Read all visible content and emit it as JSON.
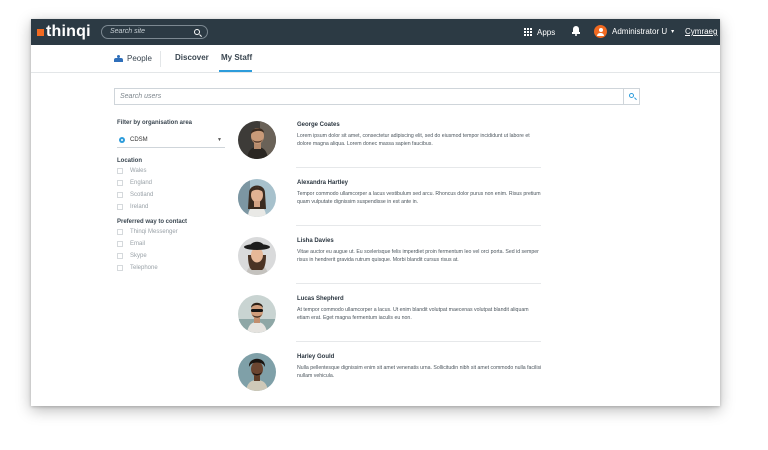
{
  "header": {
    "logo_text": "thinqi",
    "search_placeholder": "Search site",
    "apps_label": "Apps",
    "user_name": "Administrator U",
    "language_link": "Cymraeg",
    "brand_color": "#f26a21",
    "bar_color": "#2c3a44"
  },
  "nav": {
    "people_label": "People",
    "tabs": [
      {
        "label": "Discover",
        "active": false
      },
      {
        "label": "My Staff",
        "active": true
      }
    ],
    "accent_color": "#2d9cdb"
  },
  "search": {
    "placeholder": "Search users"
  },
  "filters": {
    "org_title": "Filter by organisation area",
    "org_selected": "CDSM",
    "location_title": "Location",
    "location_options": [
      "Wales",
      "England",
      "Scotland",
      "Ireland"
    ],
    "contact_title": "Preferred way to contact",
    "contact_options": [
      "Thinqi Messenger",
      "Email",
      "Skype",
      "Telephone"
    ]
  },
  "staff": [
    {
      "name": "George Coates",
      "bio": "Lorem ipsum dolor sit amet, consectetur adipiscing elit, sed do eiusmod tempor incididunt ut labore et dolore magna aliqua. Lorem donec massa sapien faucibus."
    },
    {
      "name": "Alexandra Hartley",
      "bio": "Tempor commodo ullamcorper a lacus vestibulum sed arcu. Rhoncus dolor purus non enim. Risus pretium quam vulputate dignissim suspendisse in est ante in."
    },
    {
      "name": "Lisha Davies",
      "bio": "Vitae auctor eu augue ut. Eu scelerisque felis imperdiet proin fermentum leo vel orci porta. Sed id semper risus in hendrerit gravida rutrum quisque. Morbi blandit cursus risus at."
    },
    {
      "name": "Lucas Shepherd",
      "bio": "At tempor commodo ullamcorper a lacus. Ut enim blandit volutpat maecenas volutpat blandit aliquam etiam erat. Eget magna fermentum iaculis eu non."
    },
    {
      "name": "Harley Gould",
      "bio": "Nulla pellentesque dignissim enim sit amet venenatis urna. Sollicitudin nibh sit amet commodo nulla facilisi nullam vehicula."
    }
  ]
}
